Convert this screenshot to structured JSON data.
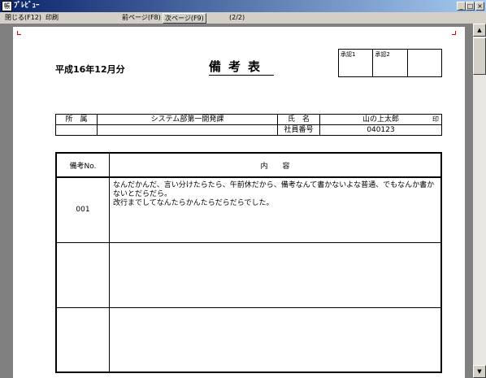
{
  "window": {
    "title": "ﾌﾟﾚﾋﾞｭｰ",
    "icon_text": "帳",
    "minimize": "_",
    "maximize": "□",
    "close": "×"
  },
  "menu": {
    "close": "閉じる(F12)",
    "print": "印刷",
    "prev_page": "前ページ(F8)",
    "next_page": "次ページ(F9)",
    "page_indicator": "(2/2)"
  },
  "scrollbar": {
    "up": "▲",
    "down": "▼"
  },
  "document": {
    "period": "平成16年12月分",
    "title": "備考表",
    "approvals": [
      "承認1",
      "承認2",
      ""
    ],
    "info": {
      "dept_label": "所　属",
      "dept_value": "システム部第一開発課",
      "name_label": "氏　名",
      "name_value": "山の上太郎",
      "seal": "印",
      "emp_label": "社員番号",
      "emp_value": "040123"
    },
    "notes_header": {
      "no": "備考No.",
      "content": "内　　容"
    },
    "rows": [
      {
        "no": "001",
        "content": "なんだかんだ、言い分けたらたら、午前休だから、備考なんて書かないよな普通、でもなんか書かないとだらだら。\n改行までしてなんたらかんたらだらだらでした。"
      },
      {
        "no": "",
        "content": ""
      },
      {
        "no": "",
        "content": ""
      }
    ]
  }
}
